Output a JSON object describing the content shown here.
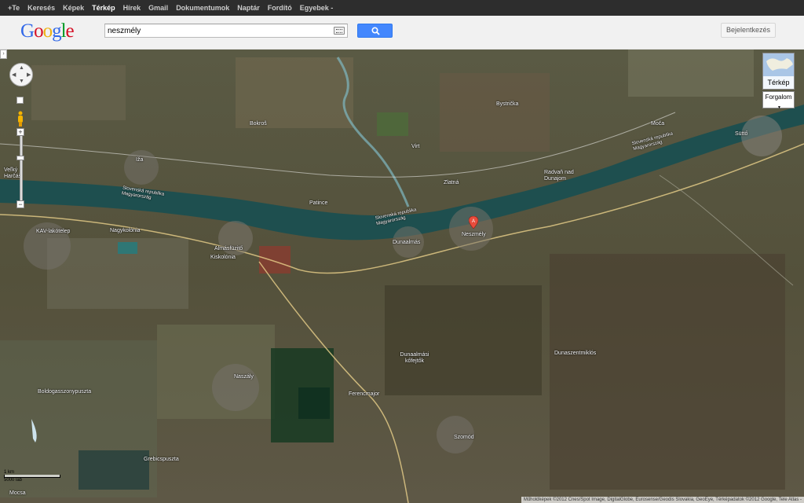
{
  "topbar": {
    "items": [
      "+Te",
      "Keresés",
      "Képek",
      "Térkép",
      "Hírek",
      "Gmail",
      "Dokumentumok",
      "Naptár",
      "Fordító",
      "Egyebek -"
    ],
    "active": "Térkép"
  },
  "logo": "Google",
  "search": {
    "value": "neszmély"
  },
  "header": {
    "signin_label": "Bejelentkezés"
  },
  "map": {
    "type_label": "Térkép",
    "traffic_label": "Forgalom",
    "scale_text": "1 km",
    "scale_text2": "5000 láb",
    "copyright": "Műholdképek ©2012 Cnes/Spot Image, DigitalGlobe, Eurosense/Geodis Slovakia, GeoEye, Térképadatok ©2012 Google, Tele Atlas -",
    "labels": {
      "bokros": "Bokroš",
      "iza": "Iža",
      "velky_harcas": "Veľký Harčáš",
      "patince": "Patince",
      "virt": "Virt",
      "ziava": "Zlatná",
      "bystricka": "Bystrička",
      "radvan": "Radvaň nad Dunajom",
      "moca": "Moča",
      "sutto": "Süttő",
      "kav": "KAV-lakótelep",
      "nagykolonia": "Nagykolónia",
      "almasfuzito": "Almásfüzitő",
      "kiskolonia": "Kiskolónia",
      "dunaalmas": "Dunaalmás",
      "neszmely": "Neszmély",
      "dunaalmasi_kofejtok": "Dunaalmási kőfejtők",
      "dunaszentmiklos": "Dunaszentmiklós",
      "naszaly": "Naszály",
      "ferencmajor": "Ferencmajor",
      "boldogasszonypuszta": "Boldogasszonypuszta",
      "szomod": "Szomód",
      "grebicspuszta": "Grebicspuszta",
      "mocsa": "Mocsa",
      "border1": "Slovenská republika Magyarország",
      "border2": "Slovenská republika Magyarország",
      "border3": "Slovenská republika Magyarország"
    }
  },
  "colors": {
    "search_blue": "#4387fd",
    "topbar": "#2d2d2d",
    "river": "#1e4f4f"
  }
}
